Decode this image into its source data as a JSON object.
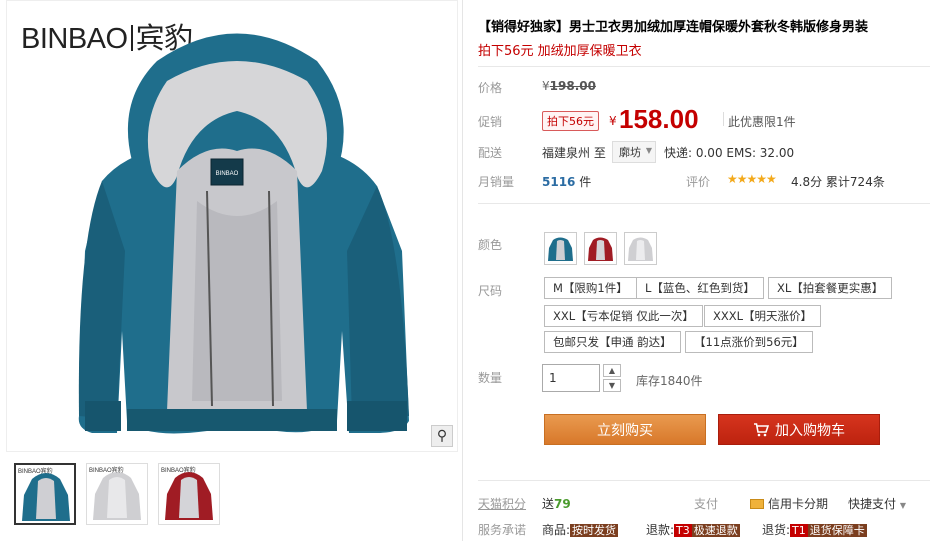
{
  "gallery": {
    "brand": "BINBAO",
    "brand_cn": "宾豹",
    "thumb_brand": "BINBAO宾豹",
    "zoom_icon": "magnifier-icon"
  },
  "product": {
    "title": "【销得好独家】男士卫衣男加绒加厚连帽保暖外套秋冬韩版修身男装",
    "subtitle": "拍下56元 加绒加厚保暖卫衣"
  },
  "price": {
    "label": "价格",
    "currency": "¥",
    "original": "198.00",
    "promo_label": "促销",
    "promo_tag": "拍下56元",
    "promo_currency": "¥",
    "promo_price": "158.00",
    "limit_note": "此优惠限1件"
  },
  "shipping": {
    "label": "配送",
    "from": "福建泉州",
    "to_word": "至",
    "to": "廓坊",
    "fee": "快递: 0.00 EMS: 32.00"
  },
  "sales": {
    "label": "月销量",
    "count": "5116",
    "unit": "件",
    "rating_label": "评价",
    "stars": "★★★★★",
    "rating": "4.8分",
    "reviews": "累计724条"
  },
  "color": {
    "label": "颜色",
    "swatches": [
      "blue",
      "red",
      "gray"
    ]
  },
  "size": {
    "label": "尺码",
    "options": [
      "M【限购1件】",
      "L【蓝色、红色到货】",
      "XL【拍套餐更实惠】",
      "XXL【亏本促销 仅此一次】",
      "XXXL【明天涨价】",
      "包邮只发【申通 韵达】",
      "【11点涨价到56元】"
    ]
  },
  "quantity": {
    "label": "数量",
    "value": "1",
    "stock": "库存1840件"
  },
  "actions": {
    "buy": "立刻购买",
    "cart": "加入购物车"
  },
  "bottom": {
    "points_label": "天猫积分",
    "points_prefix": "送",
    "points_value": "79",
    "pay_label": "支付",
    "credit": "信用卡分期",
    "fast_pay": "快捷支付",
    "service_label": "服务承诺",
    "svc1_prefix": "商品:",
    "svc1_tag": "按时发货",
    "svc2_prefix": "退款:",
    "svc2_code": "T3",
    "svc2_tag": "极速退款",
    "svc3_prefix": "退货:",
    "svc3_code": "T1",
    "svc3_tag": "退货保障卡"
  },
  "colors": {
    "accent_red": "#c40000",
    "buy_orange": "#e38a3c",
    "cart_red": "#c92a15",
    "jacket_teal": "#1f6e8c"
  }
}
